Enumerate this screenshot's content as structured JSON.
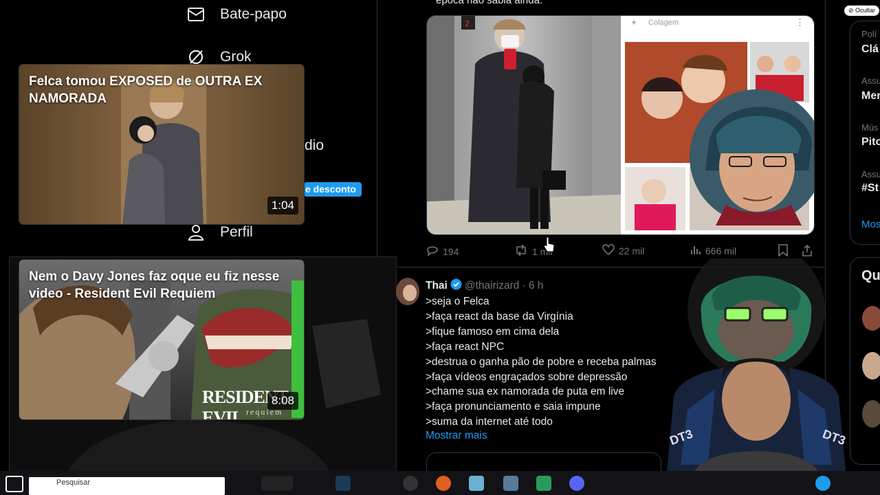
{
  "nav": {
    "chat_label": "Bate-papo",
    "grok_label": "Grok",
    "partial_label": "dio",
    "discount_label": "e desconto",
    "profile_label": "Perfil"
  },
  "videos": [
    {
      "title": "Felca tomou EXPOSED de OUTRA EX NAMORADA",
      "duration": "1:04"
    },
    {
      "title": "Nem o Davy Jones faz oque eu fiz nesse video - Resident Evil Requiem",
      "duration": "8:08",
      "game_logo": "RESIDENT EVIL",
      "game_sub": "requiem"
    }
  ],
  "post_top": {
    "partial_text": "época não sabia ainda.",
    "collage_label": "Colagem",
    "replies": "194",
    "reposts": "1 mil",
    "likes": "22 mil",
    "views": "666 mil"
  },
  "tweet": {
    "name": "Thai",
    "handle": "@thairizard",
    "time": "· 6 h",
    "lines": ">seja o Felca\n>faça react da base da Virgínia\n>fique famoso em cima dela\n>faça react NPC\n>destrua o ganha pão de pobre e receba palmas\n>faça vídeos engraçados sobre depressão\n>chame sua ex namorada de puta em live\n>faça pronunciamento e saia impune\n>suma da internet até todo",
    "show_more": "Mostrar mais"
  },
  "sidebar_right": {
    "hide_label": "Ocultar",
    "items": [
      {
        "label": "Polí",
        "value": "Clá"
      },
      {
        "label": "Assu",
        "value": "Mer"
      },
      {
        "label": "Mús",
        "value": "Pito"
      },
      {
        "label": "Assu",
        "value": "#St"
      }
    ],
    "more": "Mos",
    "who_to_follow": "Qu"
  },
  "webcam": {
    "chair_brand": "DT3"
  },
  "taskbar": {
    "search_partial": "Pesquisar"
  },
  "colors": {
    "accent": "#1d9bf0",
    "bg": "#000000",
    "muted": "#71767b"
  }
}
